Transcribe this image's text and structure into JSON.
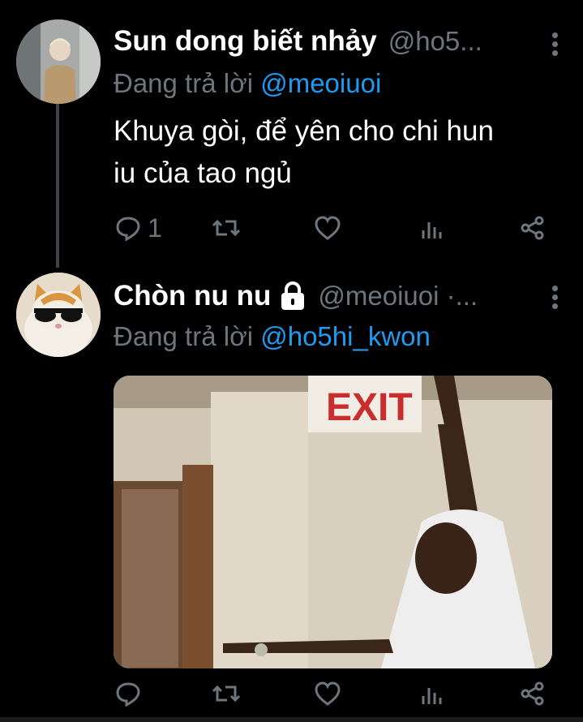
{
  "tweets": [
    {
      "author_name": "Sun dong biết nhảy",
      "handle": "@ho5...",
      "reply_prefix": "Đang trả lời",
      "reply_to": "@meoiuoi",
      "text_line1": "Khuya gòi, để yên cho chi hun",
      "text_line2": "iu của tao ngủ",
      "reply_count": "1",
      "avatar_icon": "person-avatar"
    },
    {
      "author_name": "Chòn nu nu",
      "handle": "@meoiuoi ·...",
      "reply_prefix": "Đang trả lời",
      "reply_to": "@ho5hi_kwon",
      "reply_count": "",
      "lock_icon": "lock-icon",
      "avatar_icon": "cat-with-sunglasses-avatar",
      "media_sign_text": "EXIT"
    }
  ],
  "colors": {
    "background": "#000000",
    "secondary_text": "#6e767d",
    "mention": "#1d9bf0",
    "thread_line": "#3d4348"
  }
}
